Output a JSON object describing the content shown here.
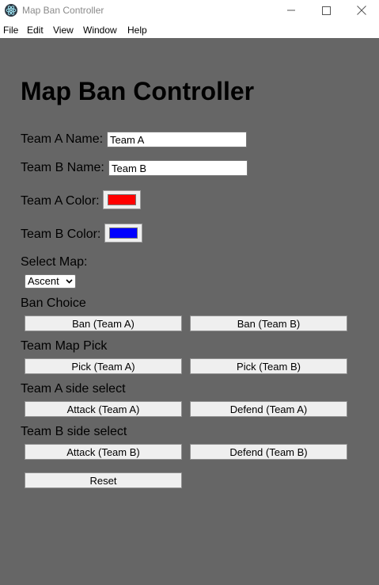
{
  "window": {
    "title": "Map Ban Controller"
  },
  "menu": [
    "File",
    "Edit",
    "View",
    "Window",
    "Help"
  ],
  "page": {
    "heading": "Map Ban Controller"
  },
  "team_a_name": {
    "label": "Team A Name:",
    "value": "Team A"
  },
  "team_b_name": {
    "label": "Team B Name:",
    "value": "Team B"
  },
  "team_a_color": {
    "label": "Team A Color:",
    "value": "#ff0000"
  },
  "team_b_color": {
    "label": "Team B Color:",
    "value": "#0000ff"
  },
  "map_select": {
    "label": "Select Map:",
    "selected": "Ascent"
  },
  "ban_choice": {
    "label": "Ban Choice",
    "buttons": [
      "Ban (Team A)",
      "Ban (Team B)"
    ]
  },
  "map_pick": {
    "label": "Team Map Pick",
    "buttons": [
      "Pick (Team A)",
      "Pick (Team B)"
    ]
  },
  "team_a_side": {
    "label": "Team A side select",
    "buttons": [
      "Attack (Team A)",
      "Defend (Team A)"
    ]
  },
  "team_b_side": {
    "label": "Team B side select",
    "buttons": [
      "Attack (Team B)",
      "Defend (Team B)"
    ]
  },
  "reset_label": "Reset",
  "colors": {
    "background": "#666666",
    "titlebar": "#ffffff",
    "button": "#efefef"
  },
  "icons": {
    "app": "electron-icon",
    "minimize": "minimize-icon",
    "maximize": "maximize-icon",
    "close": "close-icon",
    "select": "chevron-down-icon"
  }
}
